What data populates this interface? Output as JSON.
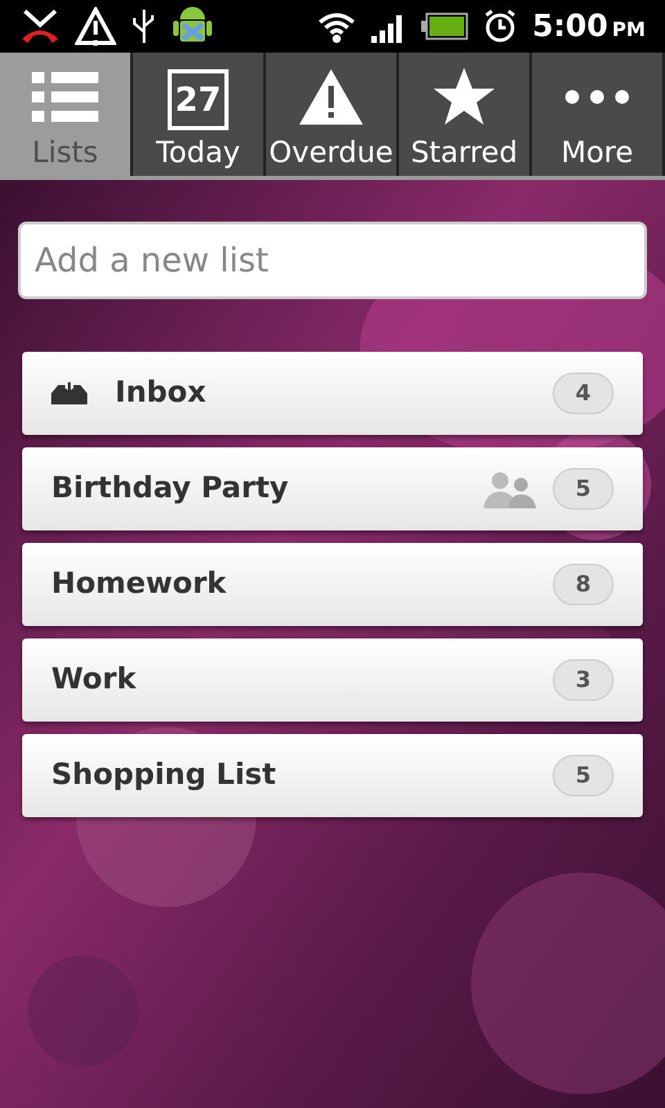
{
  "status_bar": {
    "time": "5:00",
    "ampm": "PM"
  },
  "tabs": [
    {
      "label": "Lists",
      "kind": "lists",
      "selected": true
    },
    {
      "label": "Today",
      "kind": "calendar",
      "day": "27",
      "selected": false
    },
    {
      "label": "Overdue",
      "kind": "warning",
      "selected": false
    },
    {
      "label": "Starred",
      "kind": "star",
      "selected": false
    },
    {
      "label": "More",
      "kind": "more",
      "selected": false
    }
  ],
  "new_list": {
    "placeholder": "Add a new list"
  },
  "lists": [
    {
      "name": "Inbox",
      "kind": "inbox",
      "shared": false,
      "count": "4"
    },
    {
      "name": "Birthday Party",
      "kind": "list",
      "shared": true,
      "count": "5"
    },
    {
      "name": "Homework",
      "kind": "list",
      "shared": false,
      "count": "8"
    },
    {
      "name": "Work",
      "kind": "list",
      "shared": false,
      "count": "3"
    },
    {
      "name": "Shopping List",
      "kind": "list",
      "shared": false,
      "count": "5"
    }
  ]
}
